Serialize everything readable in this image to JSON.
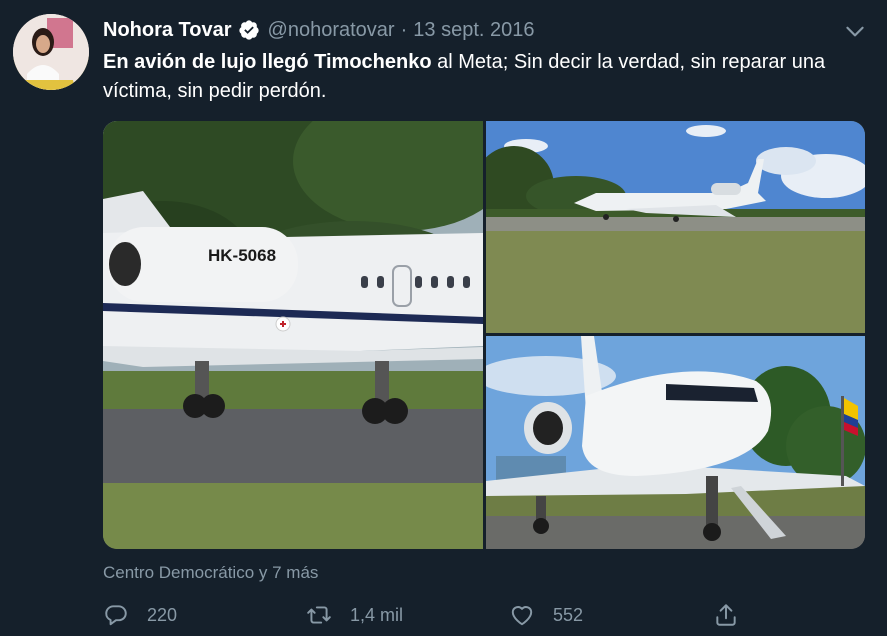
{
  "author": {
    "name": "Nohora Tovar",
    "handle": "@nohoratovar",
    "date": "13 sept. 2016"
  },
  "tweet": {
    "bold": "En avión de lujo llegó Timochenko",
    "rest": " al Meta;  Sin decir la verdad, sin reparar una víctima, sin pedir perdón."
  },
  "photos": {
    "tail_number": "HK-5068"
  },
  "tagged": "Centro Democrático y 7 más",
  "actions": {
    "replies": "220",
    "retweets": "1,4 mil",
    "likes": "552"
  },
  "icons": [
    "verified-icon",
    "caret-down-icon",
    "reply-icon",
    "retweet-icon",
    "like-icon",
    "share-icon"
  ]
}
